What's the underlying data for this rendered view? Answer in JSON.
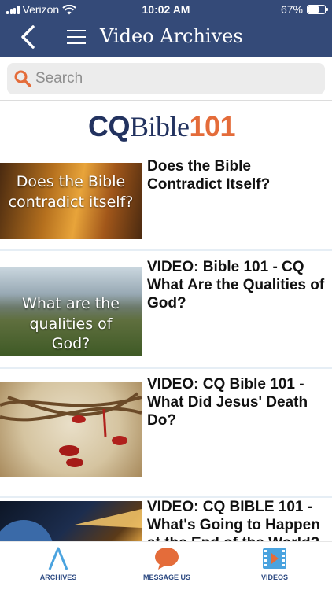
{
  "status_bar": {
    "carrier": "Verizon",
    "time": "10:02 AM",
    "battery": "67%",
    "battery_level": 0.67
  },
  "nav": {
    "title": "Video Archives",
    "back_icon": "chevron-left-icon",
    "menu_icon": "hamburger-menu-icon"
  },
  "search": {
    "placeholder": "Search",
    "value": "",
    "icon": "search-icon"
  },
  "logo": {
    "cq": "CQ",
    "bible": "Bible",
    "num": "101"
  },
  "videos": [
    {
      "title": "Does the Bible Contradict Itself?",
      "thumb_caption": "Does the Bible contradict itself?"
    },
    {
      "title": "VIDEO: Bible 101 - CQ What Are the Qualities of God?",
      "thumb_caption": "What are the qualities of God?"
    },
    {
      "title": "VIDEO:  CQ Bible 101 - What Did Jesus' Death Do?",
      "thumb_caption": ""
    },
    {
      "title": "VIDEO:  CQ BIBLE 101 - What's Going to Happen at the End of the World?",
      "thumb_caption": ""
    }
  ],
  "tabs": [
    {
      "label": "ARCHIVES",
      "icon": "archives-a-icon"
    },
    {
      "label": "MESSAGE US",
      "icon": "chat-bubble-icon"
    },
    {
      "label": "VIDEOS",
      "icon": "film-play-icon"
    }
  ],
  "colors": {
    "header": "#344a78",
    "accent": "#e46c3a",
    "tab_label": "#2d4a82"
  }
}
